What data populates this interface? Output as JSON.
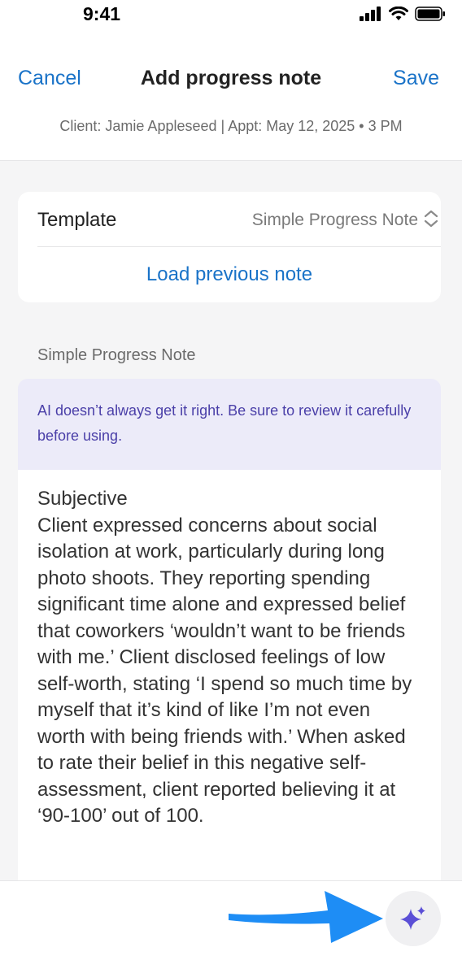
{
  "status_bar": {
    "time": "9:41"
  },
  "nav": {
    "cancel_label": "Cancel",
    "title": "Add progress note",
    "save_label": "Save",
    "subtitle": "Client: Jamie Appleseed | Appt: May 12, 2025 • 3 PM"
  },
  "template_card": {
    "label": "Template",
    "value": "Simple Progress Note",
    "load_previous_label": "Load previous note"
  },
  "section": {
    "heading": "Simple Progress Note"
  },
  "ai_banner": {
    "text": "AI doesn’t always get it right. Be sure to review it carefully before using."
  },
  "note": {
    "heading": "Subjective",
    "body": "Client expressed concerns about social isolation at work, particularly during long photo shoots. They reporting spending significant time alone and expressed belief that coworkers ‘wouldn’t want to be friends with me.’ Client disclosed feelings of low self-worth, stating ‘I spend so much time by myself that it’s kind of like I’m not even worth with being friends with.’ When asked to rate their belief in this negative self-assessment, client reported believing it at ‘90-100’ out of 100."
  },
  "colors": {
    "accent": "#1a73c8",
    "ai_text": "#4a3fa8",
    "ai_background": "#ecebf9",
    "sparkle": "#5b4fd6",
    "arrow": "#1e8df5"
  },
  "icons": {
    "signal": "cellular-signal-icon",
    "wifi": "wifi-icon",
    "battery": "battery-icon",
    "chevrons": "chevron-up-down-icon",
    "sparkle": "sparkle-ai-icon",
    "arrow": "pointer-arrow-icon"
  }
}
